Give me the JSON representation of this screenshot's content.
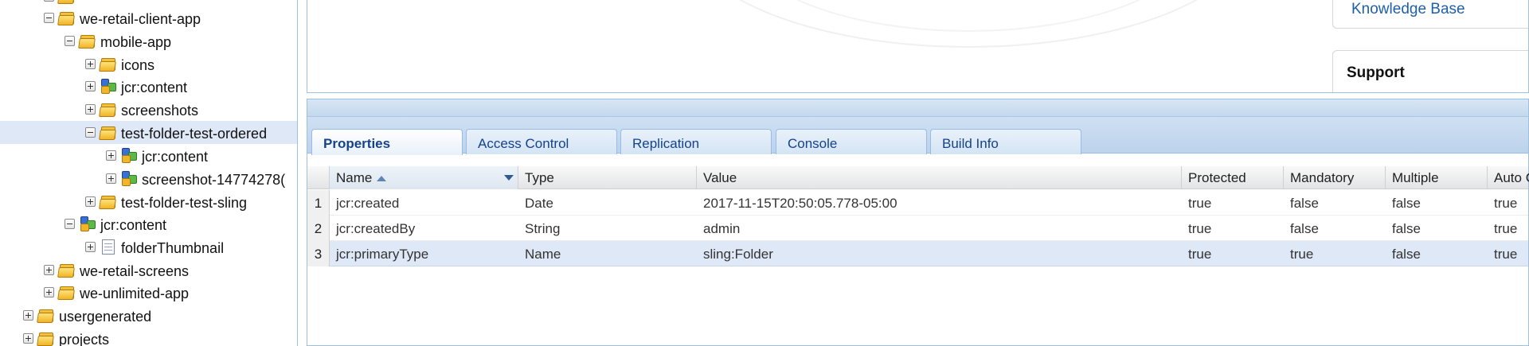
{
  "tree": {
    "nodes": [
      {
        "label": "",
        "icon": "folder-icon",
        "expanded": false,
        "selected": false
      },
      {
        "label": "we-retail-client-app",
        "icon": "folder-icon",
        "expanded": true,
        "selected": false
      },
      {
        "label": "mobile-app",
        "icon": "folder-icon",
        "expanded": true,
        "selected": false
      },
      {
        "label": "icons",
        "icon": "folder-icon",
        "expanded": false,
        "selected": false
      },
      {
        "label": "jcr:content",
        "icon": "jcr-content-icon",
        "expanded": false,
        "selected": false
      },
      {
        "label": "screenshots",
        "icon": "folder-icon",
        "expanded": false,
        "selected": false
      },
      {
        "label": "test-folder-test-ordered",
        "icon": "folder-icon",
        "expanded": true,
        "selected": true
      },
      {
        "label": "jcr:content",
        "icon": "jcr-content-icon",
        "expanded": false,
        "selected": false
      },
      {
        "label": "screenshot-14774278(",
        "icon": "jcr-content-icon",
        "expanded": false,
        "selected": false
      },
      {
        "label": "test-folder-test-sling",
        "icon": "folder-icon",
        "expanded": false,
        "selected": false
      },
      {
        "label": "jcr:content",
        "icon": "jcr-content-icon",
        "expanded": true,
        "selected": false
      },
      {
        "label": "folderThumbnail",
        "icon": "file-icon",
        "expanded": false,
        "selected": false
      },
      {
        "label": "we-retail-screens",
        "icon": "folder-icon",
        "expanded": false,
        "selected": false
      },
      {
        "label": "we-unlimited-app",
        "icon": "folder-icon",
        "expanded": false,
        "selected": false
      },
      {
        "label": "usergenerated",
        "icon": "folder-icon",
        "expanded": false,
        "selected": false
      },
      {
        "label": "projects",
        "icon": "folder-icon",
        "expanded": false,
        "selected": false
      }
    ]
  },
  "top": {
    "knowledge_base": "Knowledge Base",
    "support": "Support"
  },
  "tabs": [
    {
      "label": "Properties",
      "active": true
    },
    {
      "label": "Access Control",
      "active": false
    },
    {
      "label": "Replication",
      "active": false
    },
    {
      "label": "Console",
      "active": false
    },
    {
      "label": "Build Info",
      "active": false
    }
  ],
  "grid": {
    "columns": [
      "Name",
      "Type",
      "Value",
      "Protected",
      "Mandatory",
      "Multiple",
      "Auto C"
    ],
    "rows": [
      {
        "num": "1",
        "cells": [
          "jcr:created",
          "Date",
          "2017-11-15T20:50:05.778-05:00",
          "true",
          "false",
          "false",
          "true"
        ]
      },
      {
        "num": "2",
        "cells": [
          "jcr:createdBy",
          "String",
          "admin",
          "true",
          "false",
          "false",
          "true"
        ]
      },
      {
        "num": "3",
        "cells": [
          "jcr:primaryType",
          "Name",
          "sling:Folder",
          "true",
          "true",
          "false",
          "true"
        ]
      }
    ],
    "selected_row": 2
  },
  "colors": {
    "link": "#1f5fa8",
    "selection": "#dfe8f6",
    "tab_text": "#15428b"
  }
}
